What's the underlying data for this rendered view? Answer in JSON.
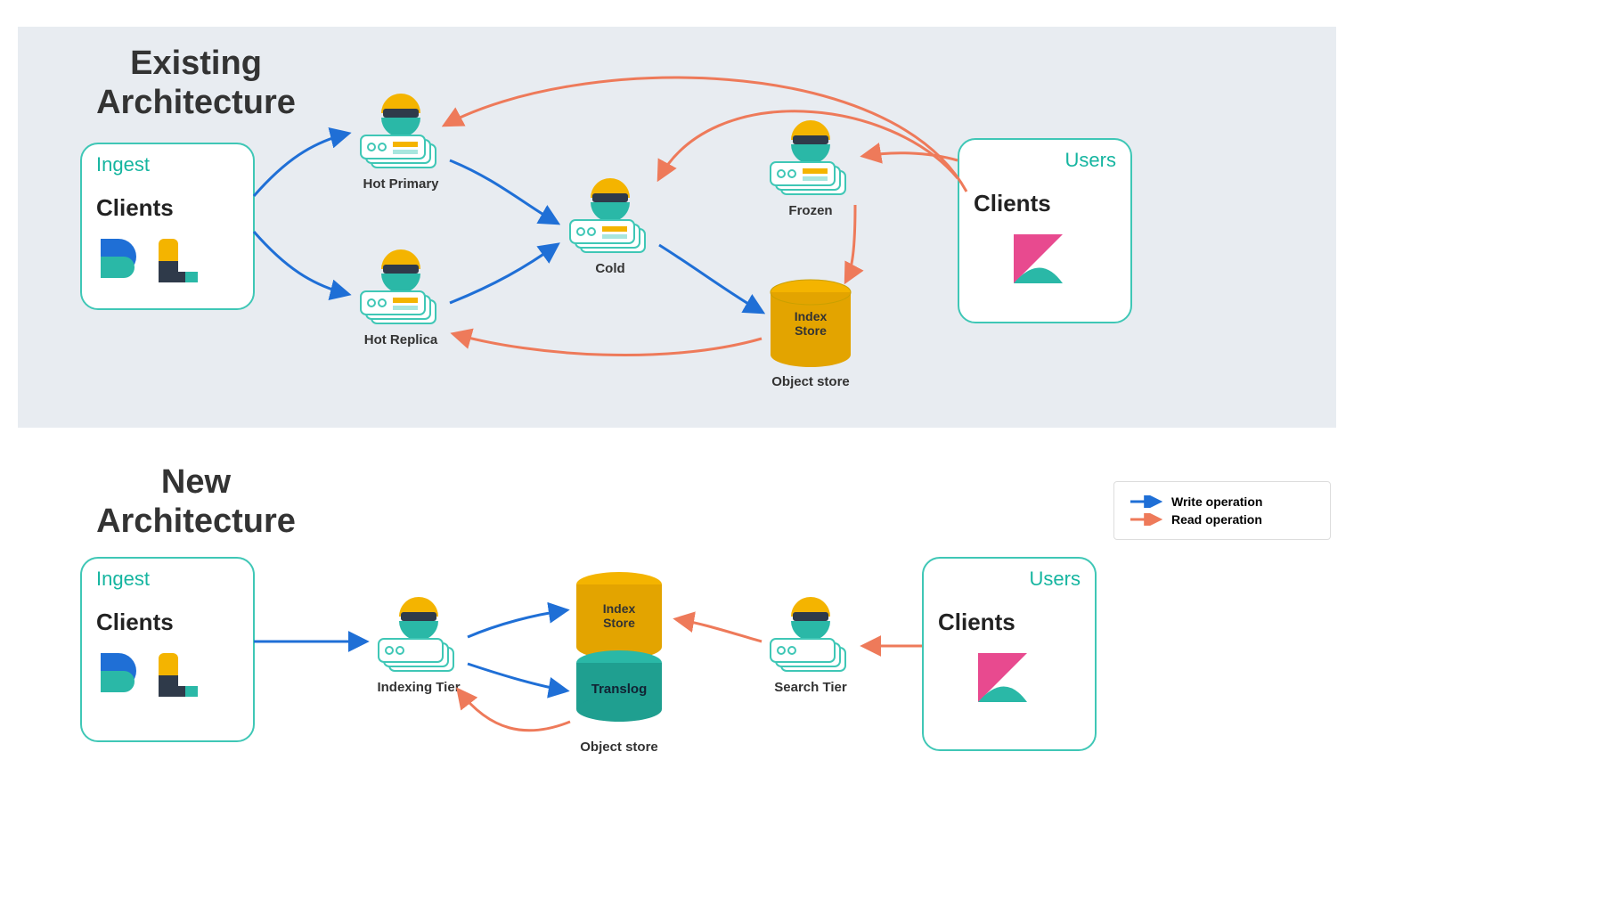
{
  "colors": {
    "write": "#1f6fd6",
    "read": "#ee7a5a",
    "teal": "#3fc7b6",
    "teal_dk": "#15b5a0",
    "yellow": "#f4b400",
    "cyl_teal": "#2ab8a7",
    "navy": "#2f3a4a",
    "pink": "#e84a8f"
  },
  "sections": {
    "existing": {
      "title": "Existing\nArchitecture"
    },
    "new": {
      "title": "New\nArchitecture"
    }
  },
  "boxes": {
    "ingest_top": {
      "title": "Ingest",
      "subtitle": "Clients"
    },
    "users_top": {
      "title": "Users",
      "subtitle": "Clients"
    },
    "ingest_bottom": {
      "title": "Ingest",
      "subtitle": "Clients"
    },
    "users_bottom": {
      "title": "Users",
      "subtitle": "Clients"
    }
  },
  "nodes": {
    "hot_primary": {
      "label": "Hot Primary"
    },
    "hot_replica": {
      "label": "Hot Replica"
    },
    "cold": {
      "label": "Cold"
    },
    "frozen": {
      "label": "Frozen"
    },
    "object_store_top": {
      "label": "Object store"
    },
    "indexing_tier": {
      "label": "Indexing Tier"
    },
    "search_tier": {
      "label": "Search Tier"
    },
    "object_store_bottom": {
      "label": "Object store"
    },
    "index_store": {
      "label": "Index\nStore"
    },
    "index_store2": {
      "label": "Index\nStore"
    },
    "translog": {
      "label": "Translog"
    }
  },
  "legend": {
    "write": "Write operation",
    "read": "Read operation"
  }
}
